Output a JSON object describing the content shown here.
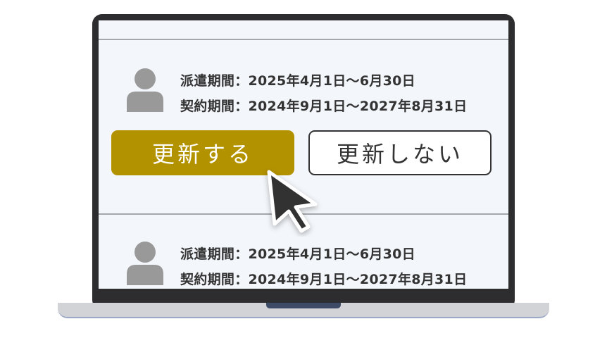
{
  "entries": [
    {
      "dispatch_period": "派遣期間：2025年4月1日～6月30日",
      "contract_period": "契約期間：2024年9月1日～2027年8月31日"
    },
    {
      "dispatch_period": "派遣期間：2025年4月1日～6月30日",
      "contract_period": "契約期間：2024年9月1日～2027年8月31日"
    }
  ],
  "actions": {
    "renew_label": "更新する",
    "no_renew_label": "更新しない"
  },
  "icons": {
    "avatar": "person-icon",
    "pointer": "mouse-cursor-icon"
  },
  "colors": {
    "renew_button": "#b39200",
    "screen_background": "#f3f6fa",
    "laptop_frame": "#2d2d2f",
    "avatar": "#999999"
  }
}
